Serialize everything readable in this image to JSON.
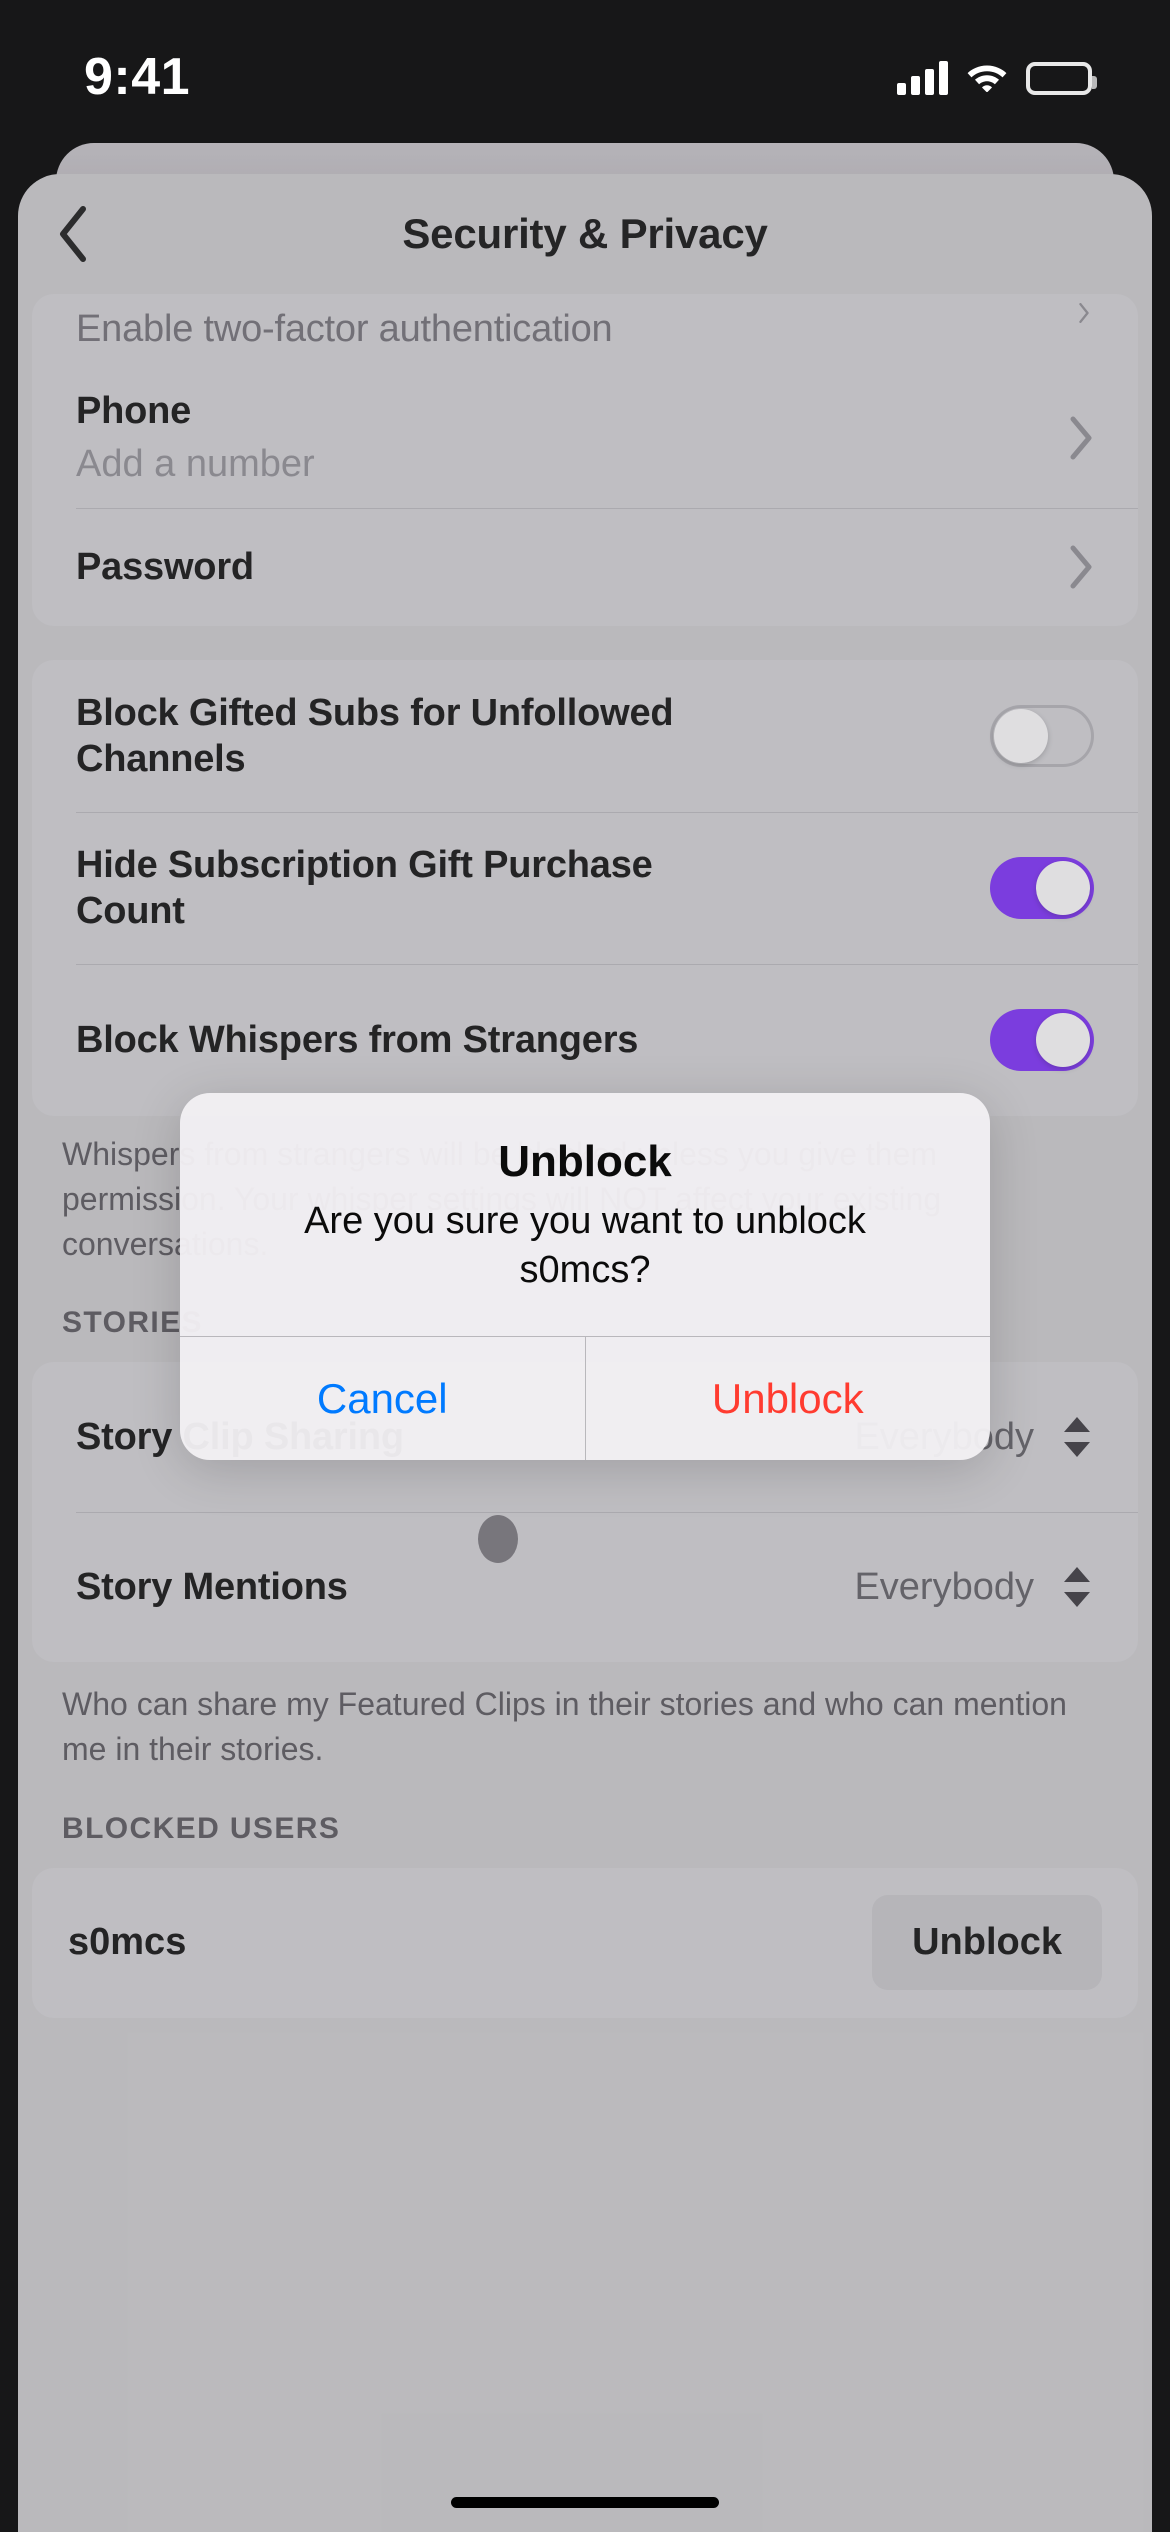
{
  "status_bar": {
    "time": "9:41",
    "icons": [
      "signal-bars-icon",
      "wifi-icon",
      "battery-icon"
    ]
  },
  "header": {
    "title": "Security & Privacy",
    "back_icon": "chevron-left-icon"
  },
  "colors": {
    "toggle_on": "#7b2ff2",
    "cancel_blue": "#007aff",
    "destructive_red": "#ff3b30",
    "sheet_bg": "#c7c6c9",
    "card_bg": "#cdccd0"
  },
  "security_card": {
    "clipped_row": {
      "title": "Enable two-factor authentication",
      "accessory": "chevron-right-icon"
    },
    "rows": [
      {
        "title": "Phone",
        "subtitle": "Add a number",
        "accessory": "chevron-right-icon"
      },
      {
        "title": "Password",
        "subtitle": "",
        "accessory": "chevron-right-icon"
      }
    ]
  },
  "subs_card": {
    "rows": [
      {
        "title": "Block Gifted Subs for Unfollowed Channels",
        "toggle": "off"
      },
      {
        "title": "Hide Subscription Gift Purchase Count",
        "toggle": "on"
      },
      {
        "title": "Block Whispers from Strangers",
        "toggle": "on"
      }
    ],
    "footnote_visible_fragments": [
      "Whis",
      "ou",
      "give",
      "OT",
      "your"
    ],
    "footnote_full": "Whispers from strangers will be blocked unless you give them permission. Your whisper settings will NOT affect your existing conversations."
  },
  "stories_section": {
    "label": "STORIES",
    "rows": [
      {
        "title": "Story Clip Sharing",
        "value": "Everybody",
        "accessory": "stepper-icon"
      },
      {
        "title": "Story Mentions",
        "value": "Everybody",
        "accessory": "stepper-icon"
      }
    ],
    "footnote": "Who can share my Featured Clips in their stories and who can mention me in their stories."
  },
  "blocked_section": {
    "label": "BLOCKED USERS",
    "users": [
      {
        "name": "s0mcs",
        "action_label": "Unblock"
      }
    ]
  },
  "alert": {
    "title": "Unblock",
    "message": "Are you sure you want to unblock s0mcs?",
    "cancel_label": "Cancel",
    "confirm_label": "Unblock"
  }
}
